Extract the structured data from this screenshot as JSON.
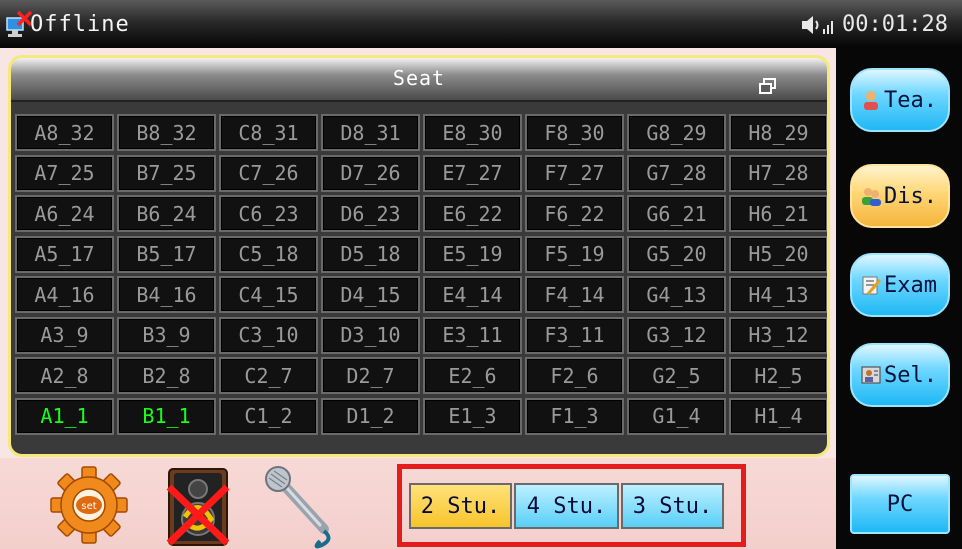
{
  "status_bar": {
    "connection_text": "Offline",
    "clock": "00:01:28",
    "status_icon": "network-offline-icon",
    "sound_icon": "speaker-signal-icon"
  },
  "seat_panel": {
    "title": "Seat",
    "restore_icon": "window-restore-icon",
    "rows": [
      [
        "A8_32",
        "B8_32",
        "C8_31",
        "D8_31",
        "E8_30",
        "F8_30",
        "G8_29",
        "H8_29"
      ],
      [
        "A7_25",
        "B7_25",
        "C7_26",
        "D7_26",
        "E7_27",
        "F7_27",
        "G7_28",
        "H7_28"
      ],
      [
        "A6_24",
        "B6_24",
        "C6_23",
        "D6_23",
        "E6_22",
        "F6_22",
        "G6_21",
        "H6_21"
      ],
      [
        "A5_17",
        "B5_17",
        "C5_18",
        "D5_18",
        "E5_19",
        "F5_19",
        "G5_20",
        "H5_20"
      ],
      [
        "A4_16",
        "B4_16",
        "C4_15",
        "D4_15",
        "E4_14",
        "F4_14",
        "G4_13",
        "H4_13"
      ],
      [
        "A3_9",
        "B3_9",
        "C3_10",
        "D3_10",
        "E3_11",
        "F3_11",
        "G3_12",
        "H3_12"
      ],
      [
        "A2_8",
        "B2_8",
        "C2_7",
        "D2_7",
        "E2_6",
        "F2_6",
        "G2_5",
        "H2_5"
      ],
      [
        "A1_1",
        "B1_1",
        "C1_2",
        "D1_2",
        "E1_3",
        "F1_3",
        "G1_4",
        "H1_4"
      ]
    ],
    "active_seats": [
      "A1_1",
      "B1_1"
    ]
  },
  "sidebar": {
    "buttons": [
      {
        "label": "Tea.",
        "icon": "teacher-icon",
        "active": false
      },
      {
        "label": "Dis.",
        "icon": "discussion-icon",
        "active": true
      },
      {
        "label": "Exam",
        "icon": "exam-icon",
        "active": false
      },
      {
        "label": "Sel.",
        "icon": "select-icon",
        "active": false
      }
    ],
    "pc_label": "PC"
  },
  "tools": {
    "settings_icon": "settings-gear-icon",
    "settings_badge": "set",
    "speaker_icon": "speaker-muted-icon",
    "mic_icon": "microphone-icon"
  },
  "student_groups": {
    "options": [
      "2 Stu.",
      "4 Stu.",
      "3 Stu."
    ],
    "selected": "2 Stu."
  },
  "colors": {
    "active_seat": "#19ff19",
    "inactive_seat": "#9a9a9a",
    "highlight_border": "#e51c1c",
    "button_blue": "#1fb8f5",
    "button_yellow": "#f5b43c"
  }
}
